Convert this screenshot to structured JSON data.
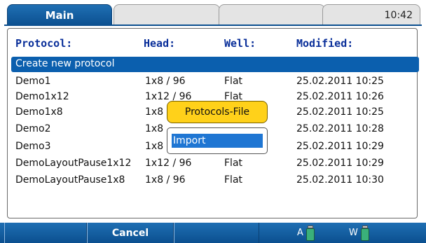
{
  "tabs": {
    "main": "Main",
    "clock": "10:42"
  },
  "headers": {
    "protocol": "Protocol:",
    "head": "Head:",
    "well": "Well:",
    "modified": "Modified:"
  },
  "selected_row": "Create new protocol",
  "rows": [
    {
      "name": "Demo1",
      "head": "1x8 / 96",
      "well": "Flat",
      "modified": "25.02.2011 10:25"
    },
    {
      "name": "Demo1x12",
      "head": "1x12 / 96",
      "well": "Flat",
      "modified": "25.02.2011 10:26"
    },
    {
      "name": "Demo1x8",
      "head": "1x8",
      "well": "",
      "modified": "25.02.2011 10:25"
    },
    {
      "name": "Demo2",
      "head": "1x8",
      "well": "",
      "modified": "25.02.2011 10:28"
    },
    {
      "name": "Demo3",
      "head": "1x8",
      "well": "",
      "modified": "25.02.2011 10:29"
    },
    {
      "name": "DemoLayoutPause1x12",
      "head": "1x12 / 96",
      "well": "Flat",
      "modified": "25.02.2011 10:29"
    },
    {
      "name": "DemoLayoutPause1x8",
      "head": "1x8 / 96",
      "well": "Flat",
      "modified": "25.02.2011 10:30"
    }
  ],
  "popup": {
    "title": "Protocols-File",
    "items": [
      "Import"
    ]
  },
  "bottom": {
    "cancel": "Cancel",
    "status_a": "A",
    "status_w": "W",
    "bottle_icon": "bottle-icon"
  }
}
